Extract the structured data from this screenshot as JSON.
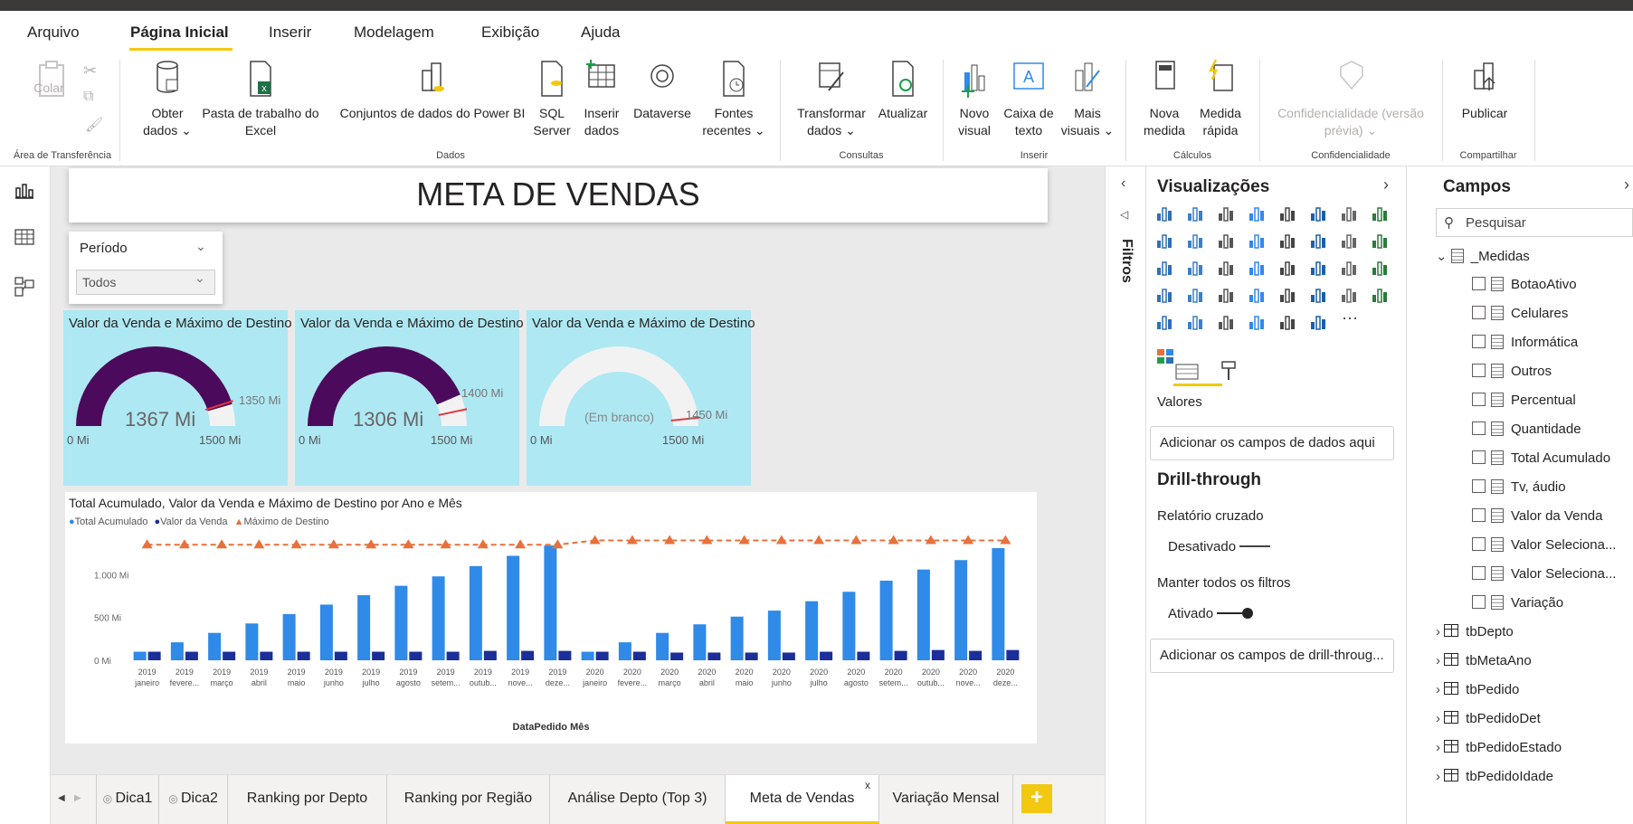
{
  "menu": {
    "items": [
      "Arquivo",
      "Página Inicial",
      "Inserir",
      "Modelagem",
      "Exibição",
      "Ajuda"
    ]
  },
  "ribbon": {
    "buttons": {
      "colar": "Colar",
      "obter_dados": "Obter dados ⌄",
      "excel": "Pasta de trabalho do Excel",
      "pbi": "Conjuntos de dados do Power BI",
      "sql": "SQL Server",
      "inserir_dados": "Inserir dados",
      "dataverse": "Dataverse",
      "fontes": "Fontes recentes ⌄",
      "transformar": "Transformar dados ⌄",
      "atualizar": "Atualizar",
      "novo_visual": "Novo visual",
      "caixa_texto": "Caixa de texto",
      "mais_visuais": "Mais visuais ⌄",
      "nova_medida": "Nova medida",
      "medida_rapida": "Medida rápida",
      "confidencialidade": "Confidencialidade (versão prévia) ⌄",
      "publicar": "Publicar"
    },
    "groups": {
      "area": "Área de Transferência",
      "dados": "Dados",
      "consultas": "Consultas",
      "inserir": "Inserir",
      "calculos": "Cálculos",
      "confidencialidade": "Confidencialidade",
      "compartilhar": "Compartilhar"
    }
  },
  "report": {
    "title": "META DE VENDAS",
    "slicer": {
      "label": "Período",
      "value": "Todos"
    },
    "gauges": [
      {
        "title": "Valor da Venda e Máximo de Destino",
        "value_label": "1367 Mi",
        "target_label": "1350 Mi",
        "min_label": "0 Mi",
        "max_label": "1500 Mi",
        "value": 1367,
        "target": 1350,
        "max": 1500
      },
      {
        "title": "Valor da Venda e Máximo de Destino",
        "value_label": "1306 Mi",
        "target_label": "1400 Mi",
        "min_label": "0 Mi",
        "max_label": "1500 Mi",
        "value": 1306,
        "target": 1400,
        "max": 1500
      },
      {
        "title": "Valor da Venda e Máximo de Destino",
        "value_label": "(Em branco)",
        "target_label": "1450 Mi",
        "min_label": "0 Mi",
        "max_label": "1500 Mi",
        "value": 0,
        "target": 1450,
        "max": 1500
      }
    ],
    "colors": {
      "gauge_fill": "#4b0a5c",
      "gauge_bg": "#f2f2f2",
      "target": "#e8333d",
      "card_bg": "#aee8f3",
      "bar_total": "#2f8ae8",
      "bar_venda": "#1b2e99",
      "line_meta": "#e8703a",
      "accent": "#f2c811"
    }
  },
  "chart_data": {
    "type": "bar",
    "title": "Total Acumulado, Valor da Venda e Máximo de Destino por Ano e Mês",
    "xlabel": "DataPedido Mês",
    "ylabel": "",
    "ylim": [
      0,
      1500
    ],
    "yticks": [
      "0 Mi",
      "500 Mi",
      "1.000 Mi"
    ],
    "ytick_values": [
      0,
      500,
      1000
    ],
    "legend_position": "top-left",
    "years": [
      "2019",
      "2019",
      "2019",
      "2019",
      "2019",
      "2019",
      "2019",
      "2019",
      "2019",
      "2019",
      "2019",
      "2019",
      "2020",
      "2020",
      "2020",
      "2020",
      "2020",
      "2020",
      "2020",
      "2020",
      "2020",
      "2020",
      "2020",
      "2020"
    ],
    "categories": [
      "janeiro",
      "fevere...",
      "março",
      "abril",
      "maio",
      "junho",
      "julho",
      "agosto",
      "setem...",
      "outub...",
      "nove...",
      "deze...",
      "janeiro",
      "fevere...",
      "março",
      "abril",
      "maio",
      "junho",
      "julho",
      "agosto",
      "setem...",
      "outub...",
      "nove...",
      "deze..."
    ],
    "series": [
      {
        "name": "Total Acumulado",
        "kind": "bar",
        "values": [
          100,
          210,
          320,
          430,
          540,
          650,
          760,
          870,
          980,
          1100,
          1220,
          1340,
          100,
          210,
          320,
          420,
          510,
          580,
          690,
          800,
          930,
          1060,
          1170,
          1310
        ]
      },
      {
        "name": "Valor da Venda",
        "kind": "bar",
        "values": [
          100,
          100,
          100,
          100,
          100,
          100,
          100,
          100,
          100,
          110,
          110,
          110,
          100,
          100,
          90,
          90,
          90,
          90,
          100,
          100,
          110,
          120,
          110,
          120
        ]
      },
      {
        "name": "Máximo de Destino",
        "kind": "line",
        "values": [
          1350,
          1350,
          1350,
          1350,
          1350,
          1350,
          1350,
          1350,
          1350,
          1350,
          1350,
          1350,
          1400,
          1400,
          1400,
          1400,
          1400,
          1400,
          1400,
          1400,
          1400,
          1400,
          1400,
          1400
        ]
      }
    ]
  },
  "tabs": {
    "items": [
      "Dica1",
      "Dica2",
      "Ranking por Depto",
      "Ranking por Região",
      "Análise Depto (Top 3)",
      "Meta de Vendas",
      "Variação Mensal"
    ],
    "close": "x",
    "add": "+"
  },
  "filters": {
    "label": "Filtros"
  },
  "viz": {
    "title": "Visualizações",
    "valores": "Valores",
    "add_fields": "Adicionar os campos de dados aqui",
    "drill_title": "Drill-through",
    "cross_report": "Relatório cruzado",
    "cross_state": "Desativado",
    "keep_filters": "Manter todos os filtros",
    "keep_state": "Ativado",
    "add_drill": "Adicionar os campos de drill-throug..."
  },
  "fields": {
    "title": "Campos",
    "search_placeholder": "Pesquisar",
    "measures_table": "_Medidas",
    "measures": [
      "BotaoAtivo",
      "Celulares",
      "Informática",
      "Outros",
      "Percentual",
      "Quantidade",
      "Total Acumulado",
      "Tv, áudio",
      "Valor da Venda",
      "Valor Seleciona...",
      "Valor Seleciona...",
      "Variação"
    ],
    "tables": [
      "tbDepto",
      "tbMetaAno",
      "tbPedido",
      "tbPedidoDet",
      "tbPedidoEstado",
      "tbPedidoIdade"
    ]
  }
}
